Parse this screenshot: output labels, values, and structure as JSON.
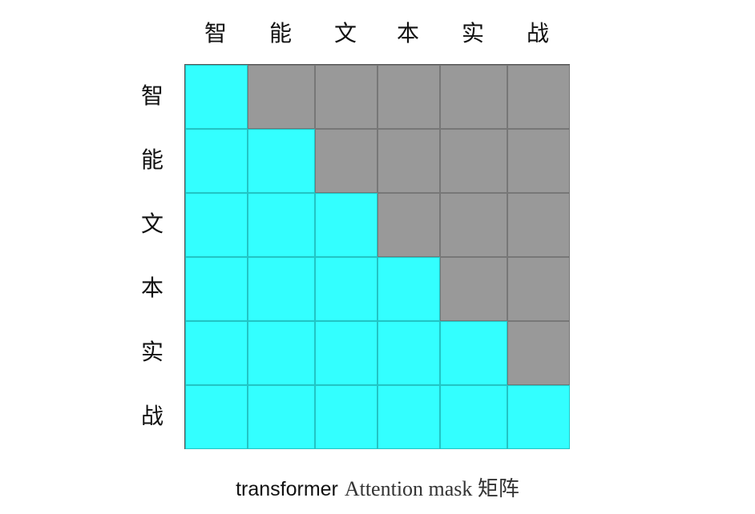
{
  "tokens": [
    "智",
    "能",
    "文",
    "本",
    "实",
    "战"
  ],
  "matrix": {
    "type": "causal-lower-triangular",
    "allowed_color": "#33ffff",
    "allowed_border": "#22c4c4",
    "masked_color": "#999999",
    "masked_border": "#777777",
    "values": [
      [
        1,
        0,
        0,
        0,
        0,
        0
      ],
      [
        1,
        1,
        0,
        0,
        0,
        0
      ],
      [
        1,
        1,
        1,
        0,
        0,
        0
      ],
      [
        1,
        1,
        1,
        1,
        0,
        0
      ],
      [
        1,
        1,
        1,
        1,
        1,
        0
      ],
      [
        1,
        1,
        1,
        1,
        1,
        1
      ]
    ]
  },
  "caption": {
    "part1": "transformer",
    "part2": "Attention mask 矩阵"
  }
}
